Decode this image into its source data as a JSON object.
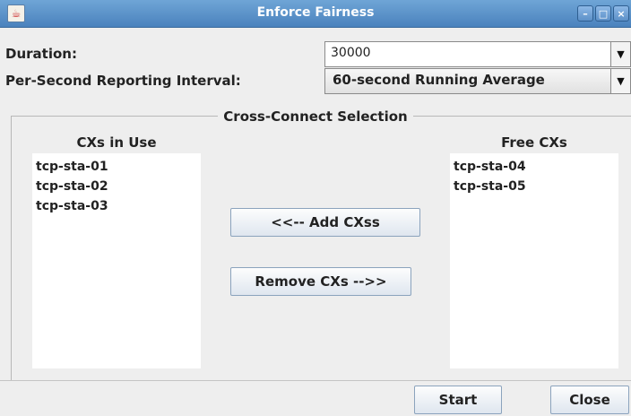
{
  "window": {
    "title": "Enforce Fairness",
    "controls": {
      "minimize": "–",
      "maximize": "□",
      "close": "×"
    }
  },
  "form": {
    "duration": {
      "label": "Duration:",
      "value": "30000"
    },
    "interval": {
      "label": "Per-Second Reporting Interval:",
      "value": "60-second Running Average"
    }
  },
  "cross_connect": {
    "title": "Cross-Connect Selection",
    "in_use": {
      "title": "CXs in Use",
      "items": [
        "tcp-sta-01",
        "tcp-sta-02",
        "tcp-sta-03"
      ]
    },
    "free": {
      "title": "Free CXs",
      "items": [
        "tcp-sta-04",
        "tcp-sta-05"
      ]
    },
    "add_button": "<<-- Add CXss",
    "remove_button": "Remove CXs -->>"
  },
  "footer": {
    "start_button": "Start",
    "close_button": "Close"
  },
  "icons": {
    "app": "java-cup-icon",
    "dropdown": "chevron-down-icon"
  },
  "colors": {
    "titlebar": "#5b91c9",
    "window_bg": "#eeeeee"
  }
}
